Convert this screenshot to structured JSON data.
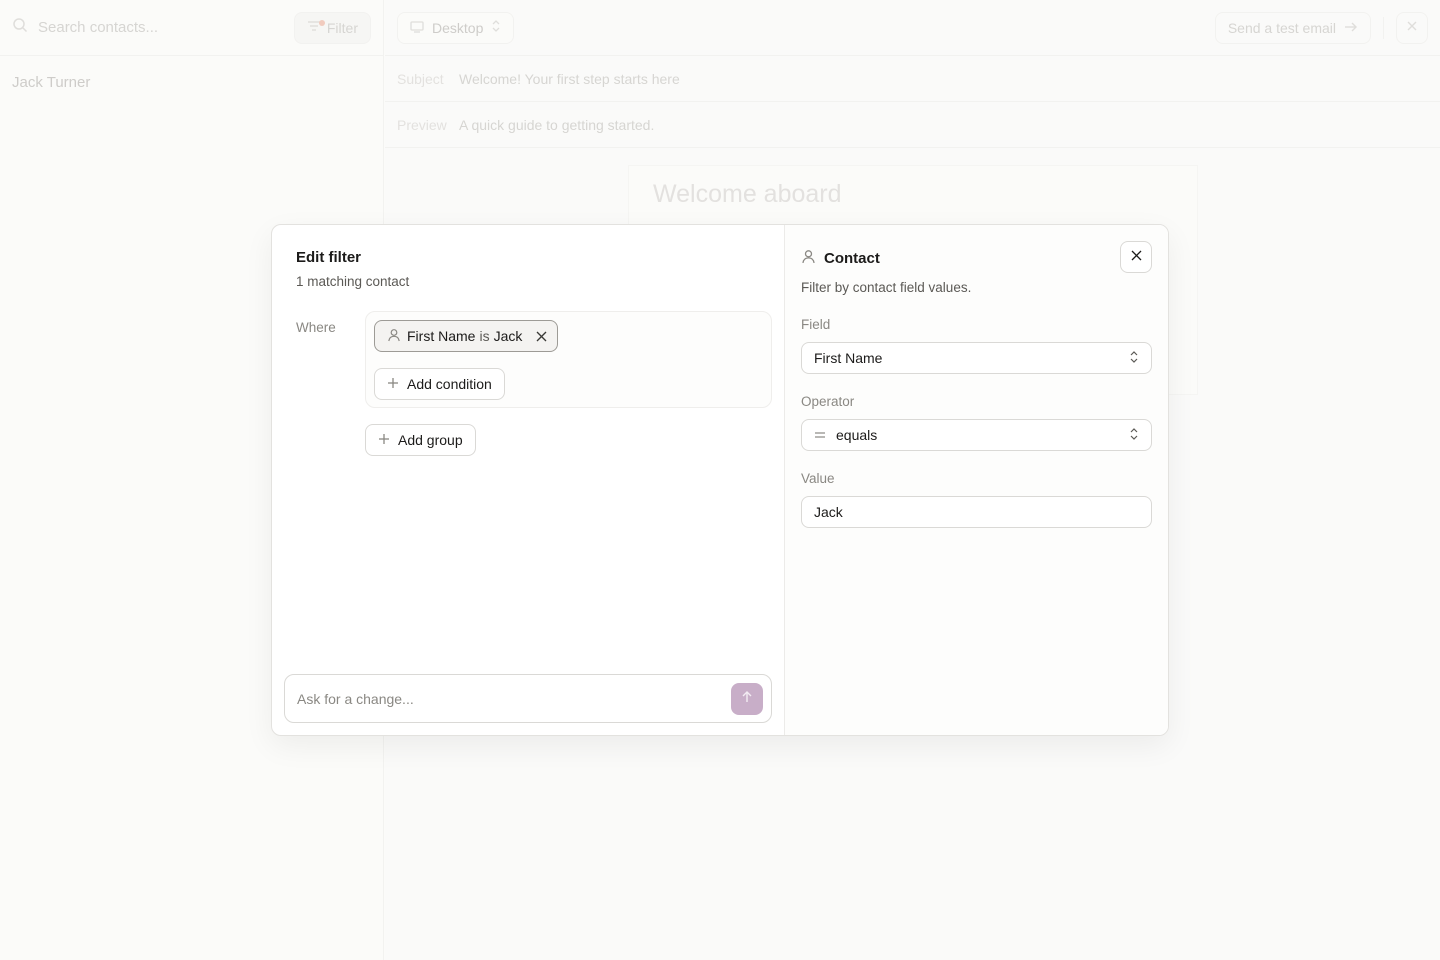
{
  "background": {
    "search": {
      "placeholder": "Search contacts..."
    },
    "filter_button": {
      "label": "Filter"
    },
    "contacts": [
      {
        "name": "Jack Turner"
      }
    ],
    "device_select": {
      "value": "Desktop"
    },
    "send_test": {
      "label": "Send a test email"
    },
    "subject": {
      "label": "Subject",
      "value": "Welcome! Your first step starts here"
    },
    "preview": {
      "label": "Preview",
      "value": "A quick guide to getting started."
    },
    "email": {
      "heading": "Welcome aboard"
    }
  },
  "modal": {
    "title": "Edit filter",
    "match_count": "1 matching contact",
    "where_label": "Where",
    "condition": {
      "field": "First Name",
      "op": "is",
      "value": "Jack"
    },
    "add_condition_label": "Add condition",
    "add_group_label": "Add group",
    "ask": {
      "placeholder": "Ask for a change..."
    },
    "panel": {
      "title": "Contact",
      "description": "Filter by contact field values.",
      "field_label": "Field",
      "field_value": "First Name",
      "operator_label": "Operator",
      "operator_value": "equals",
      "value_label": "Value",
      "value_value": "Jack"
    }
  },
  "colors": {
    "send_button": "#c8aec8",
    "chip_border": "#9d9b96"
  }
}
